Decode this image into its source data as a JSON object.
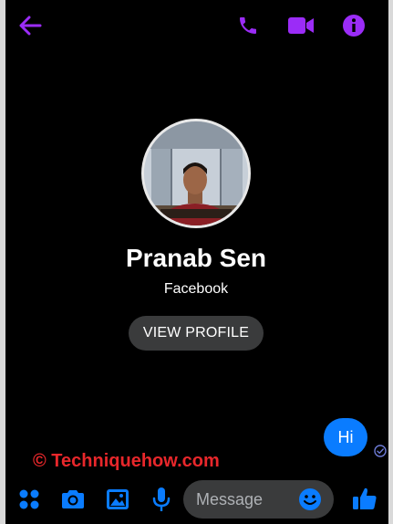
{
  "header": {
    "back_icon": "arrow-left-icon",
    "call_icon": "phone-icon",
    "video_icon": "video-camera-icon",
    "info_icon": "info-icon",
    "accent_color": "#9b2cf7"
  },
  "profile": {
    "name": "Pranab Sen",
    "subtitle": "Facebook",
    "view_profile_label": "VIEW PROFILE"
  },
  "messages": [
    {
      "text": "Hi",
      "direction": "outgoing",
      "status": "sent"
    }
  ],
  "watermark": "© Techniquehow.com",
  "composer": {
    "placeholder": "Message",
    "accent_color": "#0a7cff"
  }
}
